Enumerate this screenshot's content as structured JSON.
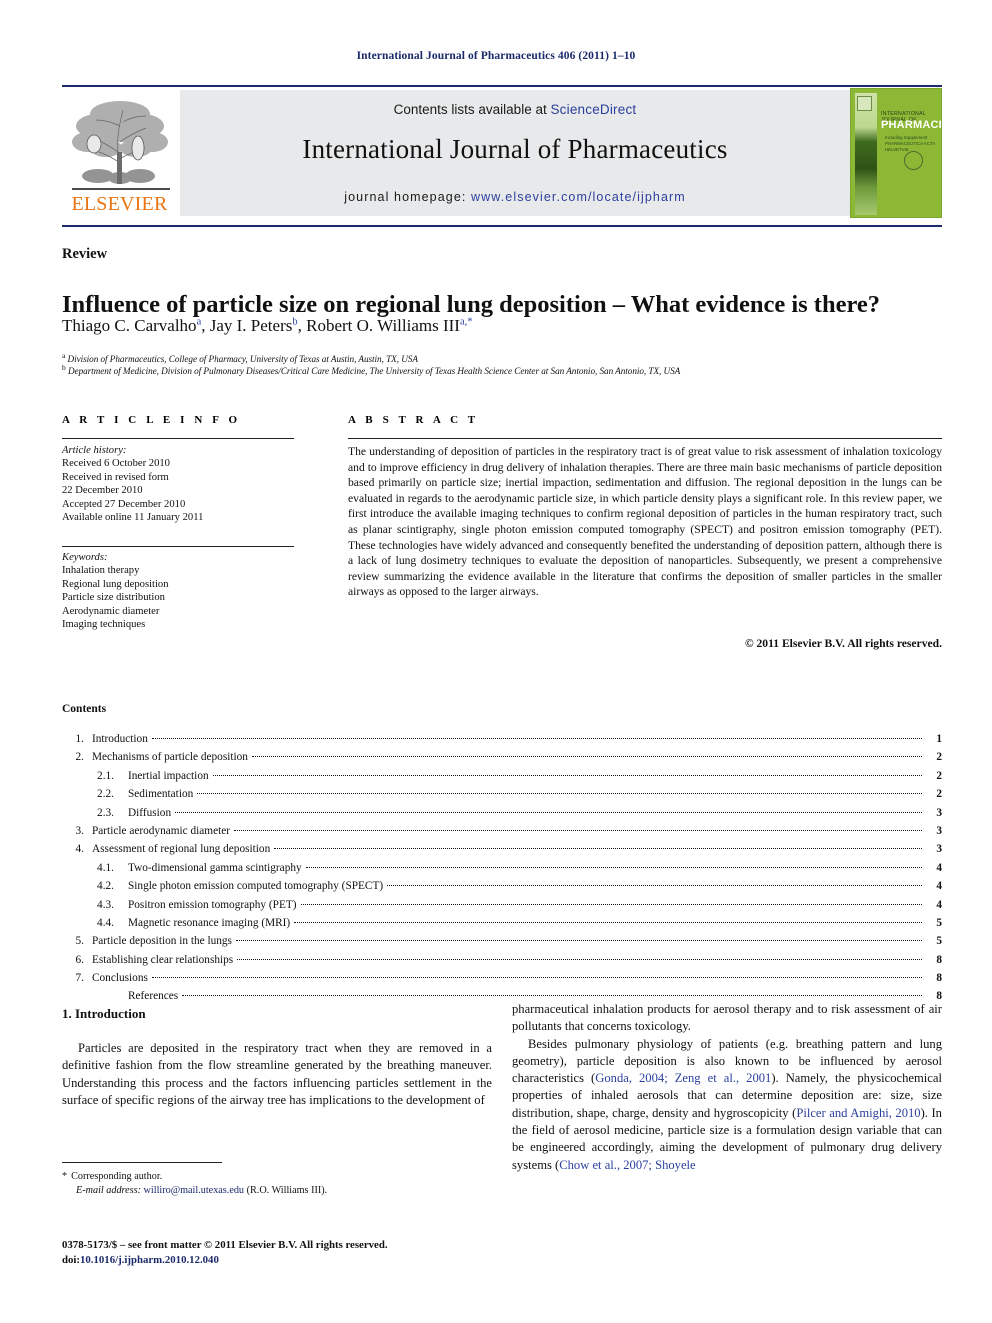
{
  "running_head": "International Journal of Pharmaceutics 406 (2011) 1–10",
  "masthead": {
    "contents_prefix": "Contents lists available at ",
    "sciencedirect": "ScienceDirect",
    "journal_name": "International Journal of Pharmaceutics",
    "homepage_label": "journal homepage:",
    "homepage_url": "www.elsevier.com/locate/ijpharm",
    "publisher": "ELSEVIER",
    "cover": {
      "line1": "INTERNATIONAL JOURNAL OF",
      "line2": "PHARMACEUTICS",
      "line3": "Including Supplement\nPHARMACEUTICA\nACTA HELVETIAE"
    },
    "colors": {
      "rule": "#1b2a6b",
      "link": "#2b3f9e",
      "band": "#e8e9ea",
      "elsevier_orange": "#e87511",
      "cover_green": "#8cb836"
    }
  },
  "article": {
    "section_word": "Review",
    "title": "Influence of particle size on regional lung deposition – What evidence is there?",
    "authors_html": "Thiago C. Carvalho<sup>a</sup>, Jay I. Peters<sup>b</sup>, Robert O. Williams III<sup>a,*</sup>",
    "affiliation_a": "Division of Pharmaceutics, College of Pharmacy, University of Texas at Austin, Austin, TX, USA",
    "affiliation_b": "Department of Medicine, Division of Pulmonary Diseases/Critical Care Medicine, The University of Texas Health Science Center at San Antonio, San Antonio, TX, USA"
  },
  "article_info": {
    "heading": "A R T I C L E    I N F O",
    "history_label": "Article history:",
    "history": [
      "Received 6 October 2010",
      "Received in revised form",
      "22 December 2010",
      "Accepted 27 December 2010",
      "Available online 11 January 2011"
    ],
    "keywords_label": "Keywords:",
    "keywords": [
      "Inhalation therapy",
      "Regional lung deposition",
      "Particle size distribution",
      "Aerodynamic diameter",
      "Imaging techniques"
    ]
  },
  "abstract": {
    "heading": "A B S T R A C T",
    "text": "The understanding of deposition of particles in the respiratory tract is of great value to risk assessment of inhalation toxicology and to improve efficiency in drug delivery of inhalation therapies. There are three main basic mechanisms of particle deposition based primarily on particle size; inertial impaction, sedimentation and diffusion. The regional deposition in the lungs can be evaluated in regards to the aerodynamic particle size, in which particle density plays a significant role. In this review paper, we first introduce the available imaging techniques to confirm regional deposition of particles in the human respiratory tract, such as planar scintigraphy, single photon emission computed tomography (SPECT) and positron emission tomography (PET). These technologies have widely advanced and consequently benefited the understanding of deposition pattern, although there is a lack of lung dosimetry techniques to evaluate the deposition of nanoparticles. Subsequently, we present a comprehensive review summarizing the evidence available in the literature that confirms the deposition of smaller particles in the smaller airways as opposed to the larger airways.",
    "copyright": "© 2011 Elsevier B.V. All rights reserved."
  },
  "contents": {
    "heading": "Contents",
    "entries": [
      {
        "num": "1.",
        "label": "Introduction",
        "page": "1",
        "level": 1
      },
      {
        "num": "2.",
        "label": "Mechanisms of particle deposition",
        "page": "2",
        "level": 1
      },
      {
        "num": "2.1.",
        "label": "Inertial impaction",
        "page": "2",
        "level": 2
      },
      {
        "num": "2.2.",
        "label": "Sedimentation",
        "page": "2",
        "level": 2
      },
      {
        "num": "2.3.",
        "label": "Diffusion",
        "page": "3",
        "level": 2
      },
      {
        "num": "3.",
        "label": "Particle aerodynamic diameter",
        "page": "3",
        "level": 1
      },
      {
        "num": "4.",
        "label": "Assessment of regional lung deposition",
        "page": "3",
        "level": 1
      },
      {
        "num": "4.1.",
        "label": "Two-dimensional gamma scintigraphy",
        "page": "4",
        "level": 2
      },
      {
        "num": "4.2.",
        "label": "Single photon emission computed tomography (SPECT)",
        "page": "4",
        "level": 2
      },
      {
        "num": "4.3.",
        "label": "Positron emission tomography (PET)",
        "page": "4",
        "level": 2
      },
      {
        "num": "4.4.",
        "label": "Magnetic resonance imaging (MRI)",
        "page": "5",
        "level": 2
      },
      {
        "num": "5.",
        "label": "Particle deposition in the lungs",
        "page": "5",
        "level": 1
      },
      {
        "num": "6.",
        "label": "Establishing clear relationships",
        "page": "8",
        "level": 1
      },
      {
        "num": "7.",
        "label": "Conclusions",
        "page": "8",
        "level": 1
      },
      {
        "num": "",
        "label": "References",
        "page": "8",
        "level": 2
      }
    ]
  },
  "body": {
    "section_number_title": "1.  Introduction",
    "left_paragraph": "Particles are deposited in the respiratory tract when they are removed in a definitive fashion from the flow streamline generated by the breathing maneuver. Understanding this process and the factors influencing particles settlement in the surface of specific regions of the airway tree has implications to the development of",
    "right_paragraph_1": "pharmaceutical inhalation products for aerosol therapy and to risk assessment of air pollutants that concerns toxicology.",
    "right_paragraph_2_parts": {
      "t1": "Besides pulmonary physiology of patients (e.g. breathing pattern and lung geometry), particle deposition is also known to be influenced by aerosol characteristics (",
      "c1": "Gonda, 2004; Zeng et al., 2001",
      "t2": "). Namely, the physicochemical properties of inhaled aerosols that can determine deposition are: size, size distribution, shape, charge, density and hygroscopicity (",
      "c2": "Pilcer and Amighi, 2010",
      "t3": "). In the field of aerosol medicine, particle size is a formulation design variable that can be engineered accordingly, aiming the development of pulmonary drug delivery systems (",
      "c3": "Chow et al., 2007; Shoyele"
    }
  },
  "footer": {
    "corresponding_star": "*",
    "corresponding_label": "Corresponding author.",
    "email_label": "E-mail address:",
    "email": "williro@mail.utexas.edu",
    "email_owner": "(R.O. Williams III).",
    "imprint_line": "0378-5173/$ – see front matter © 2011 Elsevier B.V. All rights reserved.",
    "doi_label": "doi:",
    "doi": "10.1016/j.ijpharm.2010.12.040"
  }
}
